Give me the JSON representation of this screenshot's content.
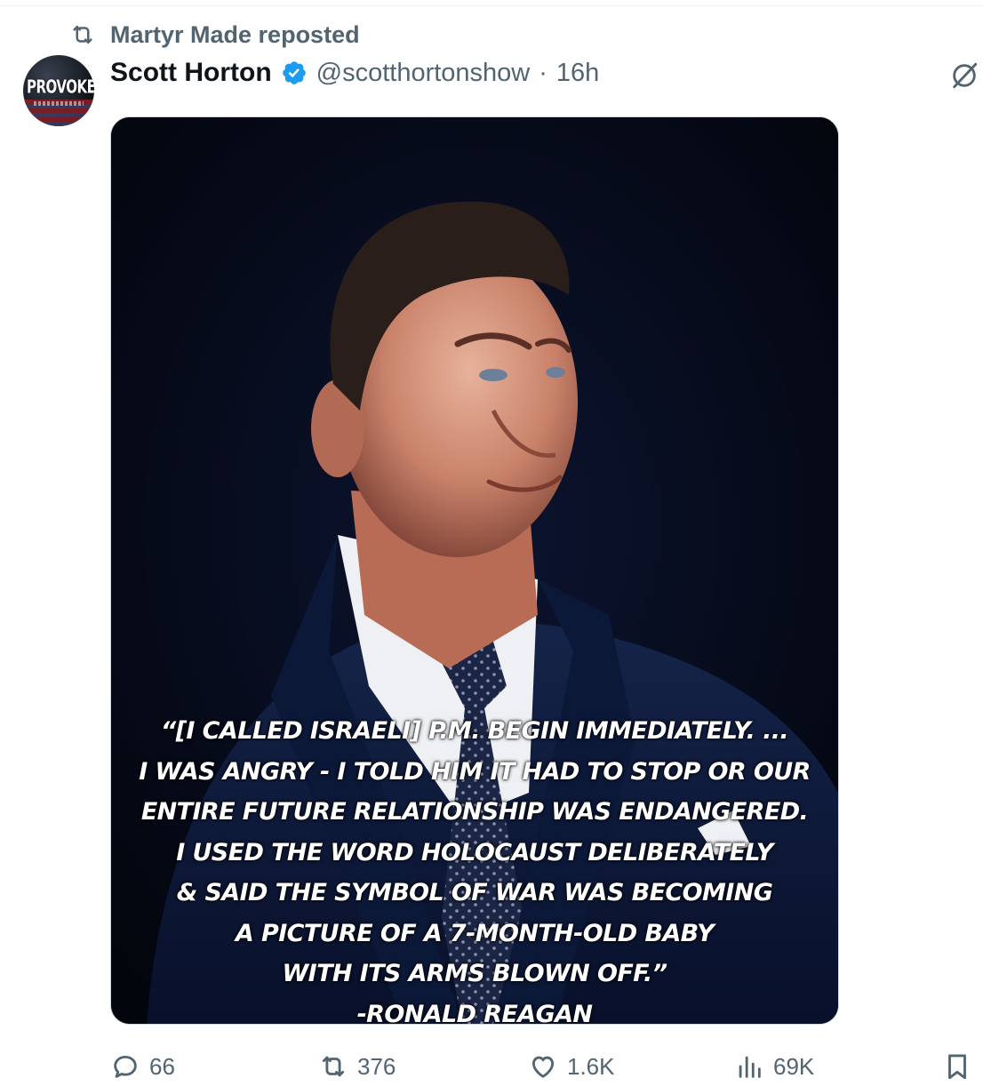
{
  "repost": {
    "text": "Martyr Made reposted"
  },
  "author": {
    "avatar_text": "PROVOKED",
    "name": "Scott Horton",
    "handle": "@scotthortonshow",
    "separator": "·",
    "time": "16h"
  },
  "media": {
    "quote_lines": [
      "“[I CALLED ISRAELI] P.M. BEGIN IMMEDIATELY. ...",
      "I WAS ANGRY - I TOLD HIM IT HAD TO STOP OR OUR",
      "ENTIRE FUTURE RELATIONSHIP WAS ENDANGERED.",
      "I USED THE WORD HOLOCAUST DELIBERATELY",
      "& SAID THE SYMBOL OF WAR WAS BECOMING",
      "A PICTURE OF A 7-MONTH-OLD BABY",
      "WITH ITS ARMS BLOWN OFF.”",
      "-RONALD REAGAN"
    ]
  },
  "actions": {
    "replies": "66",
    "reposts": "376",
    "likes": "1.6K",
    "views": "69K"
  },
  "colors": {
    "verified": "#1d9bf0",
    "muted": "#536471",
    "text": "#0f1419"
  }
}
